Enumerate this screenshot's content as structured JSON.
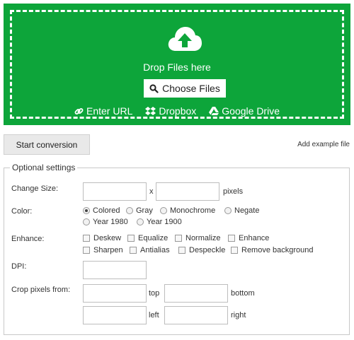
{
  "dropzone": {
    "upload_icon": "cloud-upload-icon",
    "drop_text": "Drop Files here",
    "choose_label": "Choose Files",
    "choose_icon": "search-icon",
    "enter_url": "Enter URL",
    "dropbox": "Dropbox",
    "google_drive": "Google Drive",
    "bg_color": "#0da53a"
  },
  "actions": {
    "start_label": "Start conversion",
    "example_label": "Add example file"
  },
  "settings": {
    "legend": "Optional settings",
    "change_size": {
      "label": "Change Size:",
      "x": "x",
      "unit": "pixels",
      "width": "",
      "height": ""
    },
    "color": {
      "label": "Color:",
      "options": [
        "Colored",
        "Gray",
        "Monochrome",
        "Negate",
        "Year 1980",
        "Year 1900"
      ],
      "selected": "Colored"
    },
    "enhance": {
      "label": "Enhance:",
      "options": [
        "Deskew",
        "Equalize",
        "Normalize",
        "Enhance",
        "Sharpen",
        "Antialias",
        "Despeckle",
        "Remove background"
      ]
    },
    "dpi": {
      "label": "DPI:",
      "value": ""
    },
    "crop": {
      "label": "Crop pixels from:",
      "top": "top",
      "bottom": "bottom",
      "left": "left",
      "right": "right"
    }
  }
}
